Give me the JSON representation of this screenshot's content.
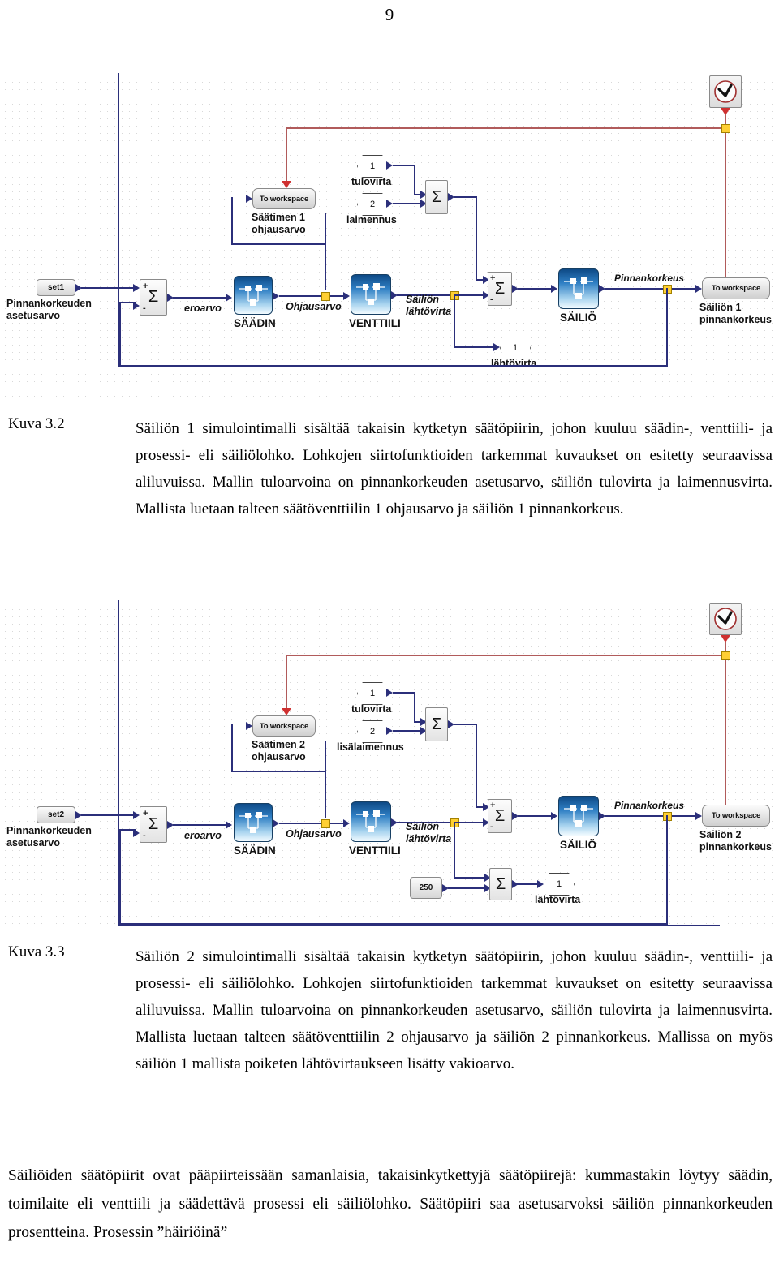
{
  "page": {
    "number": "9"
  },
  "figure1": {
    "name": "Säiliön 1 simulointimalli",
    "blocks": {
      "setpoint_const": "set1",
      "setpoint_label": "Pinnankorkeuden\nasetusarvo",
      "sum1_plus": "+",
      "sum1_minus": "-",
      "sum_glyph": "Σ",
      "error_signal": "eroarvo",
      "controller": "SÄÄDIN",
      "control_signal": "Ohjausarvo",
      "valve": "VENTTIILI",
      "tank_outflow_signal": "Säiliön\nlähtövirta",
      "tank": "SÄILIÖ",
      "level_signal": "Pinnankorkeus",
      "to_workspace": "To workspace",
      "ws_controller_label": "Säätimen 1\nohjausarvo",
      "ws_level_label": "Säiliön 1\npinnankorkeus",
      "inport1_num": "1",
      "inport1_label": "tulovirta",
      "inport2_num": "2",
      "inport2_label": "laimennus",
      "outport1_num": "1",
      "outport1_label": "lähtövirta",
      "clock_icon": "clock-icon"
    }
  },
  "caption1": {
    "id": "Kuva 3.2",
    "text": "Säiliön 1 simulointimalli sisältää takaisin kytketyn säätöpiirin, johon kuuluu säädin-, venttiili- ja prosessi- eli säiliölohko. Lohkojen siirtofunktioiden tarkemmat kuvaukset on esitetty seuraavissa aliluvuissa. Mallin tuloarvoina on pinnankorkeuden asetusarvo, säiliön tulovirta ja laimennusvirta. Mallista luetaan talteen säätöventtiilin 1 ohjausarvo ja säiliön 1 pinnankorkeus."
  },
  "figure2": {
    "name": "Säiliön 2 simulointimalli",
    "blocks": {
      "setpoint_const": "set2",
      "setpoint_label": "Pinnankorkeuden\nasetusarvo",
      "sum1_plus": "+",
      "sum1_minus": "-",
      "sum_glyph": "Σ",
      "error_signal": "eroarvo",
      "controller": "SÄÄDIN",
      "control_signal": "Ohjausarvo",
      "valve": "VENTTIILI",
      "tank_outflow_signal": "Säiliön\nlähtövirta",
      "tank": "SÄILIÖ",
      "level_signal": "Pinnankorkeus",
      "to_workspace": "To workspace",
      "ws_controller_label": "Säätimen 2\nohjausarvo",
      "ws_level_label": "Säiliön 2\npinnankorkeus",
      "inport1_num": "1",
      "inport1_label": "tulovirta",
      "inport2_num": "2",
      "inport2_label": "lisälaimennus",
      "outport1_num": "1",
      "outport1_label": "lähtövirta",
      "constant_250": "250",
      "clock_icon": "clock-icon"
    }
  },
  "caption2": {
    "id": "Kuva 3.3",
    "text": "Säiliön 2 simulointimalli sisältää takaisin kytketyn säätöpiirin, johon kuuluu säädin-, venttiili- ja prosessi- eli säiliölohko. Lohkojen siirtofunktioiden tarkemmat kuvaukset on esitetty seuraavissa aliluvuissa. Mallin tuloarvoina on pinnankorkeuden asetusarvo, säiliön tulovirta ja laimennusvirta. Mallista luetaan talteen säätöventtiilin 2 ohjausarvo ja säiliön 2 pinnankorkeus. Mallissa on myös säiliön 1 mallista poiketen lähtövirtaukseen lisätty vakioarvo."
  },
  "body_paragraph": "Säiliöiden säätöpiirit ovat pääpiirteissään samanlaisia, takaisinkytkettyjä säätöpiirejä: kummastakin löytyy säädin, toimilaite eli venttiili ja säädettävä prosessi eli säiliölohko. Säätöpiiri saa asetusarvoksi säiliön pinnankorkeuden prosentteina. Prosessin ”häiriöinä”"
}
